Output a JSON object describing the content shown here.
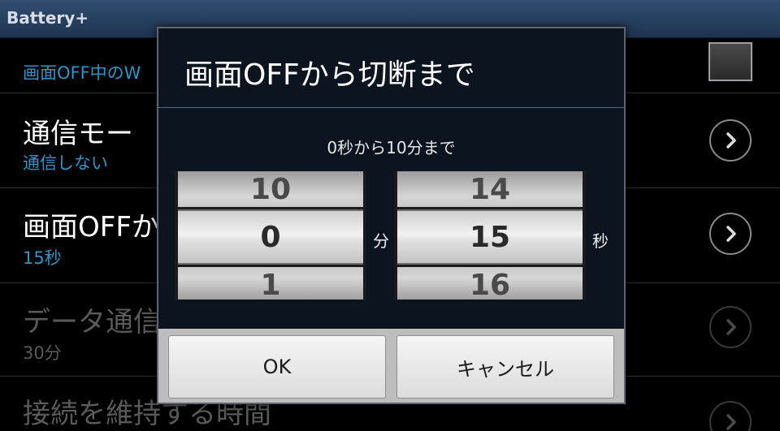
{
  "app": {
    "title": "Battery+"
  },
  "list": [
    {
      "title": "",
      "subtitle": "画面OFF中のW",
      "control": "checkbox"
    },
    {
      "title": "通信モー",
      "subtitle": "通信しない",
      "control": "chevron"
    },
    {
      "title": "画面OFFか",
      "subtitle": "15秒",
      "control": "chevron"
    },
    {
      "title": "データ通信",
      "subtitle": "30分",
      "control": "chevron",
      "disabled": true
    },
    {
      "title": "接続を維持する時間",
      "subtitle": "",
      "control": "chevron",
      "disabled": true
    }
  ],
  "dialog": {
    "title": "画面OFFから切断まで",
    "range_text": "0秒から10分まで",
    "minutes_picker": {
      "prev": "10",
      "current": "0",
      "next": "1",
      "unit": "分"
    },
    "seconds_picker": {
      "prev": "14",
      "current": "15",
      "next": "16",
      "unit": "秒"
    },
    "ok_label": "OK",
    "cancel_label": "キャンセル"
  },
  "colors": {
    "titlebar": "#1d3450",
    "subtitle_accent": "#2f95c9",
    "dialog_bg": "#0c1420",
    "button_bar": "#bdbdbd"
  },
  "icons": [
    "chevron-right-icon",
    "checkbox-icon"
  ]
}
